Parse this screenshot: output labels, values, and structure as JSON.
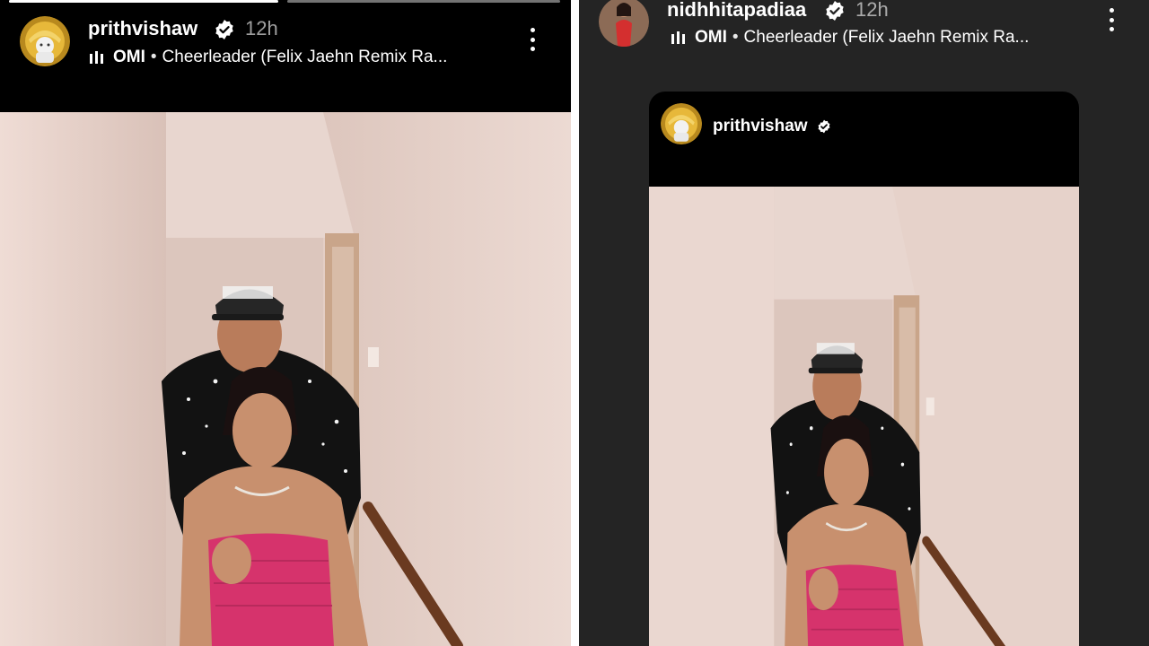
{
  "left_story": {
    "username": "prithvishaw",
    "time": "12h",
    "music": {
      "artist": "OMI",
      "separator": "•",
      "title": "Cheerleader (Felix Jaehn Remix Ra..."
    },
    "progress_segments": [
      1.0,
      0.0
    ]
  },
  "right_story": {
    "username": "nidhhitapadiaa",
    "time": "12h",
    "music": {
      "artist": "OMI",
      "separator": "•",
      "title": "Cheerleader (Felix Jaehn Remix Ra..."
    },
    "shared_post": {
      "username": "prithvishaw"
    }
  },
  "icons": [
    "verified-badge-icon",
    "music-bars-icon",
    "more-options-icon"
  ],
  "colors": {
    "story_bg": "#000000",
    "viewer_bg": "#242424",
    "dress": "#d6336c",
    "wall": "#e7d1c9"
  }
}
